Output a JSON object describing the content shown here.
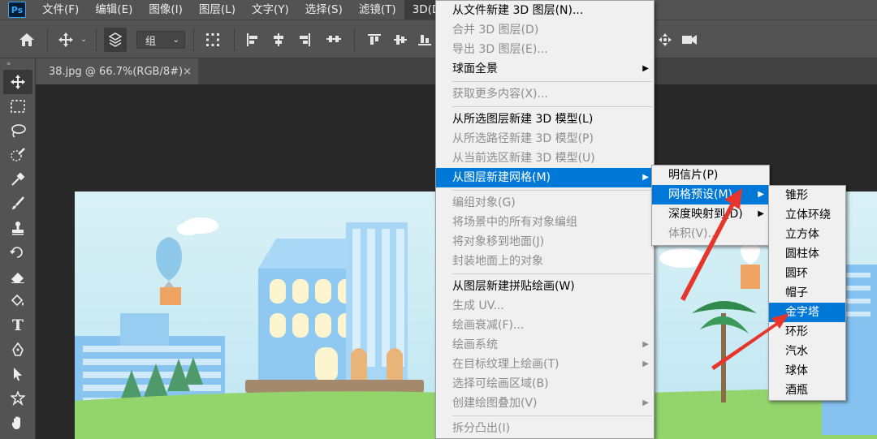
{
  "menubar": {
    "logo": "Ps",
    "items": [
      "文件(F)",
      "编辑(E)",
      "图像(I)",
      "图层(L)",
      "文字(Y)",
      "选择(S)",
      "滤镜(T)",
      "3D(D)"
    ]
  },
  "options": {
    "group_label": "组"
  },
  "document": {
    "tab_title": "38.jpg @ 66.7%(RGB/8#)",
    "close": "×"
  },
  "menu3d": {
    "items": [
      {
        "label": "从文件新建 3D 图层(N)...",
        "disabled": false
      },
      {
        "label": "合并 3D 图层(D)",
        "disabled": true
      },
      {
        "label": "导出 3D 图层(E)...",
        "disabled": true
      },
      {
        "label": "球面全景",
        "disabled": false,
        "submenu": true
      },
      {
        "label": "获取更多内容(X)...",
        "disabled": true
      },
      {
        "label": "从所选图层新建 3D 模型(L)",
        "disabled": false
      },
      {
        "label": "从所选路径新建 3D 模型(P)",
        "disabled": true
      },
      {
        "label": "从当前选区新建 3D 模型(U)",
        "disabled": true
      },
      {
        "label": "从图层新建网格(M)",
        "disabled": false,
        "submenu": true,
        "highlighted": true
      },
      {
        "label": "编组对象(G)",
        "disabled": true
      },
      {
        "label": "将场景中的所有对象编组",
        "disabled": true
      },
      {
        "label": "将对象移到地面(J)",
        "disabled": true
      },
      {
        "label": "封装地面上的对象",
        "disabled": true
      },
      {
        "label": "从图层新建拼贴绘画(W)",
        "disabled": false
      },
      {
        "label": "生成 UV...",
        "disabled": true
      },
      {
        "label": "绘画衰减(F)...",
        "disabled": true
      },
      {
        "label": "绘画系统",
        "disabled": true,
        "submenu": true
      },
      {
        "label": "在目标纹理上绘画(T)",
        "disabled": true,
        "submenu": true
      },
      {
        "label": "选择可绘画区域(B)",
        "disabled": true
      },
      {
        "label": "创建绘图叠加(V)",
        "disabled": true,
        "submenu": true
      },
      {
        "label": "拆分凸出(I)",
        "disabled": true
      }
    ]
  },
  "menuMesh": {
    "items": [
      {
        "label": "明信片(P)",
        "disabled": false
      },
      {
        "label": "网格预设(M)",
        "disabled": false,
        "submenu": true,
        "highlighted": true
      },
      {
        "label": "深度映射到(D)",
        "disabled": false,
        "submenu": true
      },
      {
        "label": "体积(V)...",
        "disabled": true
      }
    ]
  },
  "menuPreset": {
    "items": [
      {
        "label": "锥形"
      },
      {
        "label": "立体环绕"
      },
      {
        "label": "立方体"
      },
      {
        "label": "圆柱体"
      },
      {
        "label": "圆环"
      },
      {
        "label": "帽子"
      },
      {
        "label": "金字塔",
        "highlighted": true
      },
      {
        "label": "环形"
      },
      {
        "label": "汽水"
      },
      {
        "label": "球体"
      },
      {
        "label": "酒瓶"
      }
    ]
  },
  "colors": {
    "menu_highlight": "#0078d7",
    "annotation_arrow": "#e8352b"
  }
}
